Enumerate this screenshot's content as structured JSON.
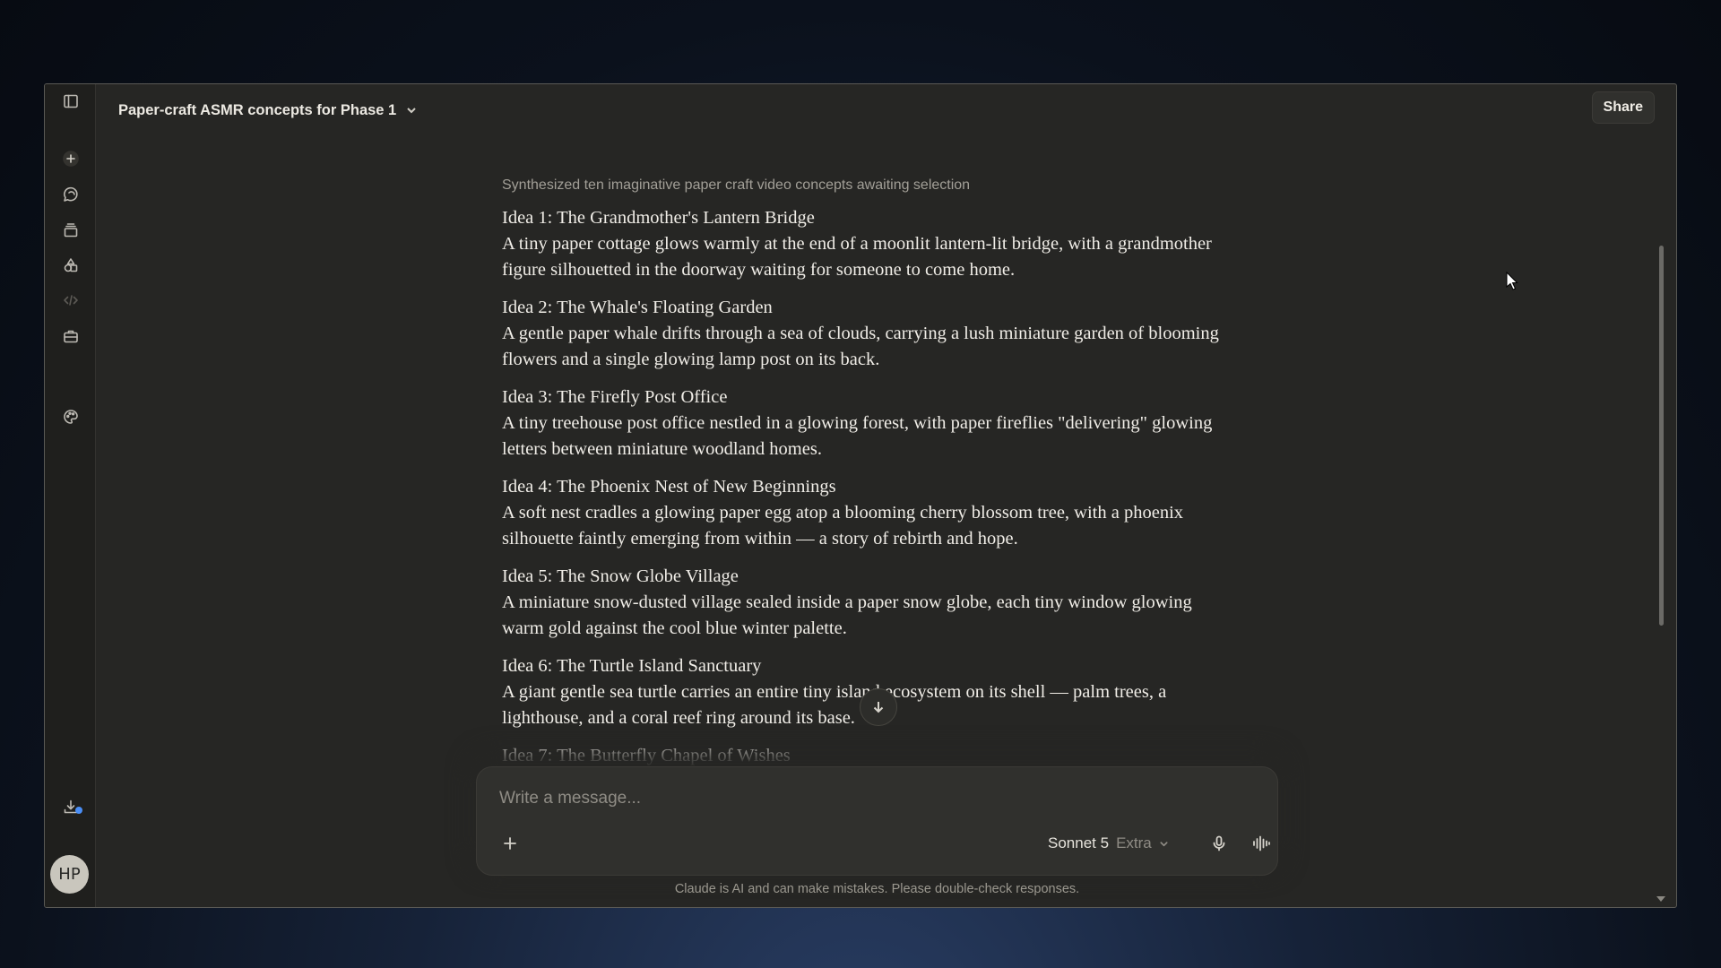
{
  "header": {
    "title": "Paper-craft ASMR concepts for Phase 1",
    "share_label": "Share"
  },
  "sidebar": {
    "icons": [
      "sidebar-toggle-icon",
      "new-chat-icon",
      "chats-icon",
      "projects-icon",
      "artifacts-icon",
      "code-icon",
      "briefcase-icon",
      "palette-icon",
      "download-icon"
    ],
    "avatar_initials": "HP"
  },
  "thread": {
    "status": "Synthesized ten imaginative paper craft video concepts awaiting selection",
    "ideas": [
      {
        "title": "Idea 1: The Grandmother's Lantern Bridge",
        "description": "A tiny paper cottage glows warmly at the end of a moonlit lantern-lit bridge, with a grandmother figure silhouetted in the doorway waiting for someone to come home."
      },
      {
        "title": "Idea 2: The Whale's Floating Garden",
        "description": "A gentle paper whale drifts through a sea of clouds, carrying a lush miniature garden of blooming flowers and a single glowing lamp post on its back."
      },
      {
        "title": "Idea 3: The Firefly Post Office",
        "description": "A tiny treehouse post office nestled in a glowing forest, with paper fireflies \"delivering\" glowing letters between miniature woodland homes."
      },
      {
        "title": "Idea 4: The Phoenix Nest of New Beginnings",
        "description": "A soft nest cradles a glowing paper egg atop a blooming cherry blossom tree, with a phoenix silhouette faintly emerging from within — a story of rebirth and hope."
      },
      {
        "title": "Idea 5: The Snow Globe Village",
        "description": "A miniature snow-dusted village sealed inside a paper snow globe, each tiny window glowing warm gold against the cool blue winter palette."
      },
      {
        "title": "Idea 6: The Turtle Island Sanctuary",
        "description": "A giant gentle sea turtle carries an entire tiny island ecosystem on its shell — palm trees, a lighthouse, and a coral reef ring around its base."
      },
      {
        "title": "Idea 7: The Butterfly Chapel of Wishes",
        "description": ""
      }
    ]
  },
  "composer": {
    "placeholder": "Write a message...",
    "model_name": "Sonnet 5",
    "model_mode": "Extra"
  },
  "footer": {
    "disclaimer": "Claude is AI and can make mistakes. Please double-check responses."
  }
}
